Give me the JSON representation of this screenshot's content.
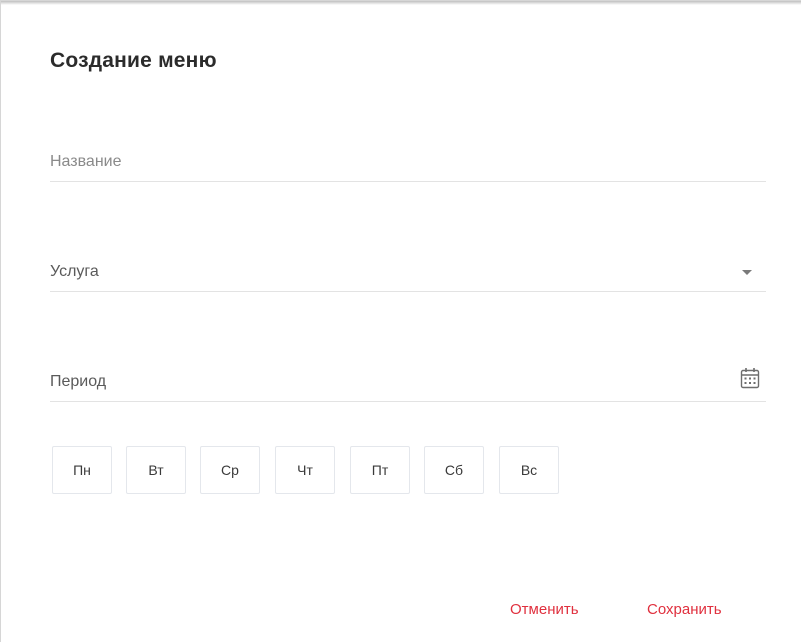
{
  "dialog": {
    "title": "Создание меню"
  },
  "fields": {
    "name": {
      "placeholder": "Название"
    },
    "service": {
      "placeholder": "Услуга",
      "icon": "chevron-down-icon"
    },
    "period": {
      "placeholder": "Период",
      "icon": "calendar-icon"
    }
  },
  "weekdays": [
    "Пн",
    "Вт",
    "Ср",
    "Чт",
    "Пт",
    "Сб",
    "Вс"
  ],
  "actions": {
    "cancel_label": "Отменить",
    "save_label": "Сохранить"
  },
  "colors": {
    "accent": "#e0303e",
    "border": "#e4e7ec"
  }
}
